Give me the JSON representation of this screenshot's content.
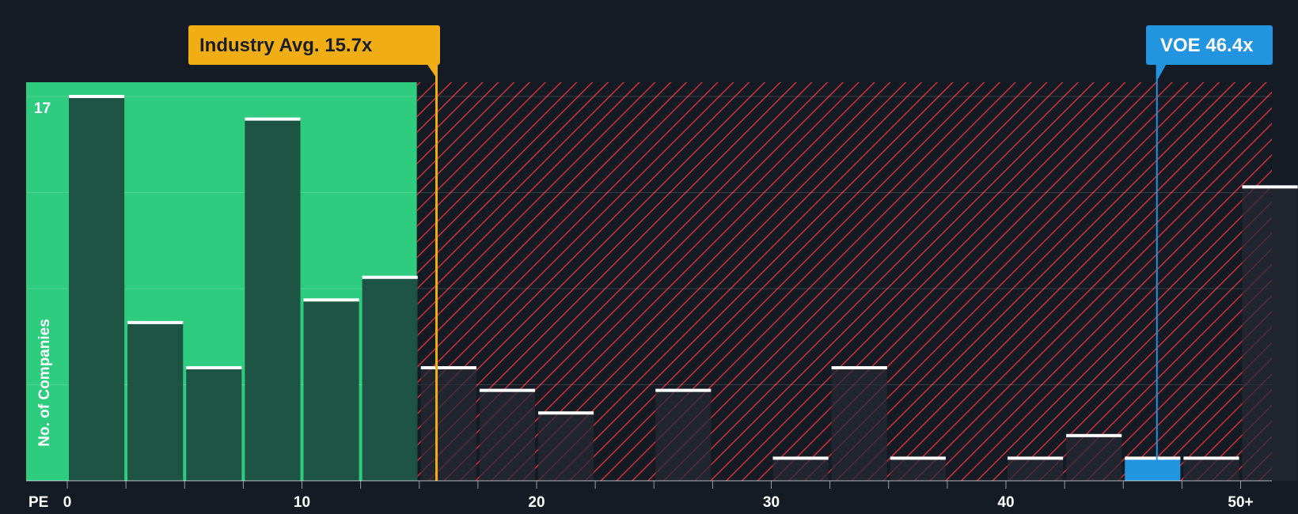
{
  "chart_data": {
    "type": "bar",
    "title": "",
    "xlabel": "PE",
    "ylabel": "No. of Companies",
    "xlim": [
      0,
      51.5
    ],
    "ylim": [
      0,
      17.6
    ],
    "bin_width": 2.5,
    "x_ticks": [
      {
        "value": 0,
        "label": "0"
      },
      {
        "value": 10,
        "label": "10"
      },
      {
        "value": 20,
        "label": "20"
      },
      {
        "value": 30,
        "label": "30"
      },
      {
        "value": 40,
        "label": "40"
      },
      {
        "value": 50,
        "label": "50+"
      }
    ],
    "y_tick_label": {
      "value": 17,
      "label": "17"
    },
    "y_gridlines": [
      4.25,
      8.5,
      12.75,
      17
    ],
    "bins": [
      {
        "start": 0,
        "count": 17
      },
      {
        "start": 2.5,
        "count": 7
      },
      {
        "start": 5,
        "count": 5
      },
      {
        "start": 7.5,
        "count": 16
      },
      {
        "start": 10,
        "count": 8
      },
      {
        "start": 12.5,
        "count": 9
      },
      {
        "start": 15,
        "count": 5
      },
      {
        "start": 17.5,
        "count": 4
      },
      {
        "start": 20,
        "count": 3
      },
      {
        "start": 22.5,
        "count": 0
      },
      {
        "start": 25,
        "count": 4
      },
      {
        "start": 27.5,
        "count": 0
      },
      {
        "start": 30,
        "count": 1
      },
      {
        "start": 32.5,
        "count": 5
      },
      {
        "start": 35,
        "count": 1
      },
      {
        "start": 37.5,
        "count": 0
      },
      {
        "start": 40,
        "count": 1
      },
      {
        "start": 42.5,
        "count": 2
      },
      {
        "start": 45,
        "count": 1,
        "highlight": true
      },
      {
        "start": 47.5,
        "count": 1
      },
      {
        "start": 50,
        "count": 13
      }
    ],
    "fair_zone_end": 15,
    "industry_avg": {
      "value": 15.7,
      "label": "Industry Avg. 15.7x"
    },
    "company": {
      "value": 46.4,
      "label": "VOE 46.4x"
    },
    "colors": {
      "background": "#151b24",
      "fair_zone": "#2ecc7f",
      "bar_in_fair_zone": "#1c4a3e",
      "overvalued_hatch": "#c2303a",
      "bar_overvalued": "#262a33",
      "bar_cap": "#ffffff",
      "industry_marker": "#f0ad14",
      "company_marker": "#2394e0",
      "axis_text": "#ffffff"
    }
  }
}
